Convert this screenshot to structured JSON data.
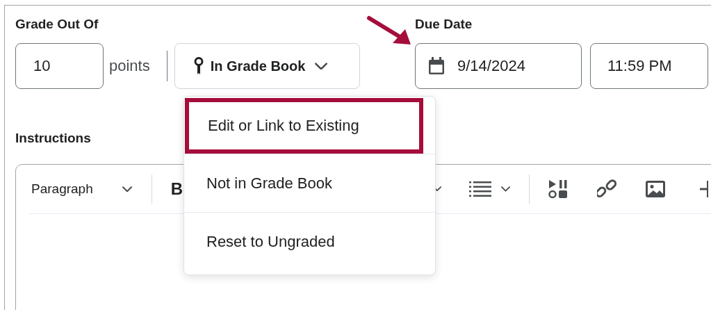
{
  "grade": {
    "label": "Grade Out Of",
    "value": "10",
    "unit": "points",
    "gradebook_button": "In Grade Book"
  },
  "due_date": {
    "label": "Due Date",
    "date": "9/14/2024",
    "time": "11:59 PM"
  },
  "instructions": {
    "label": "Instructions",
    "toolbar": {
      "format": "Paragraph",
      "bold": "B"
    }
  },
  "menu": {
    "items": [
      {
        "label": "Edit or Link to Existing",
        "highlighted": true
      },
      {
        "label": "Not in Grade Book",
        "highlighted": false
      },
      {
        "label": "Reset to Ungraded",
        "highlighted": false
      }
    ]
  }
}
